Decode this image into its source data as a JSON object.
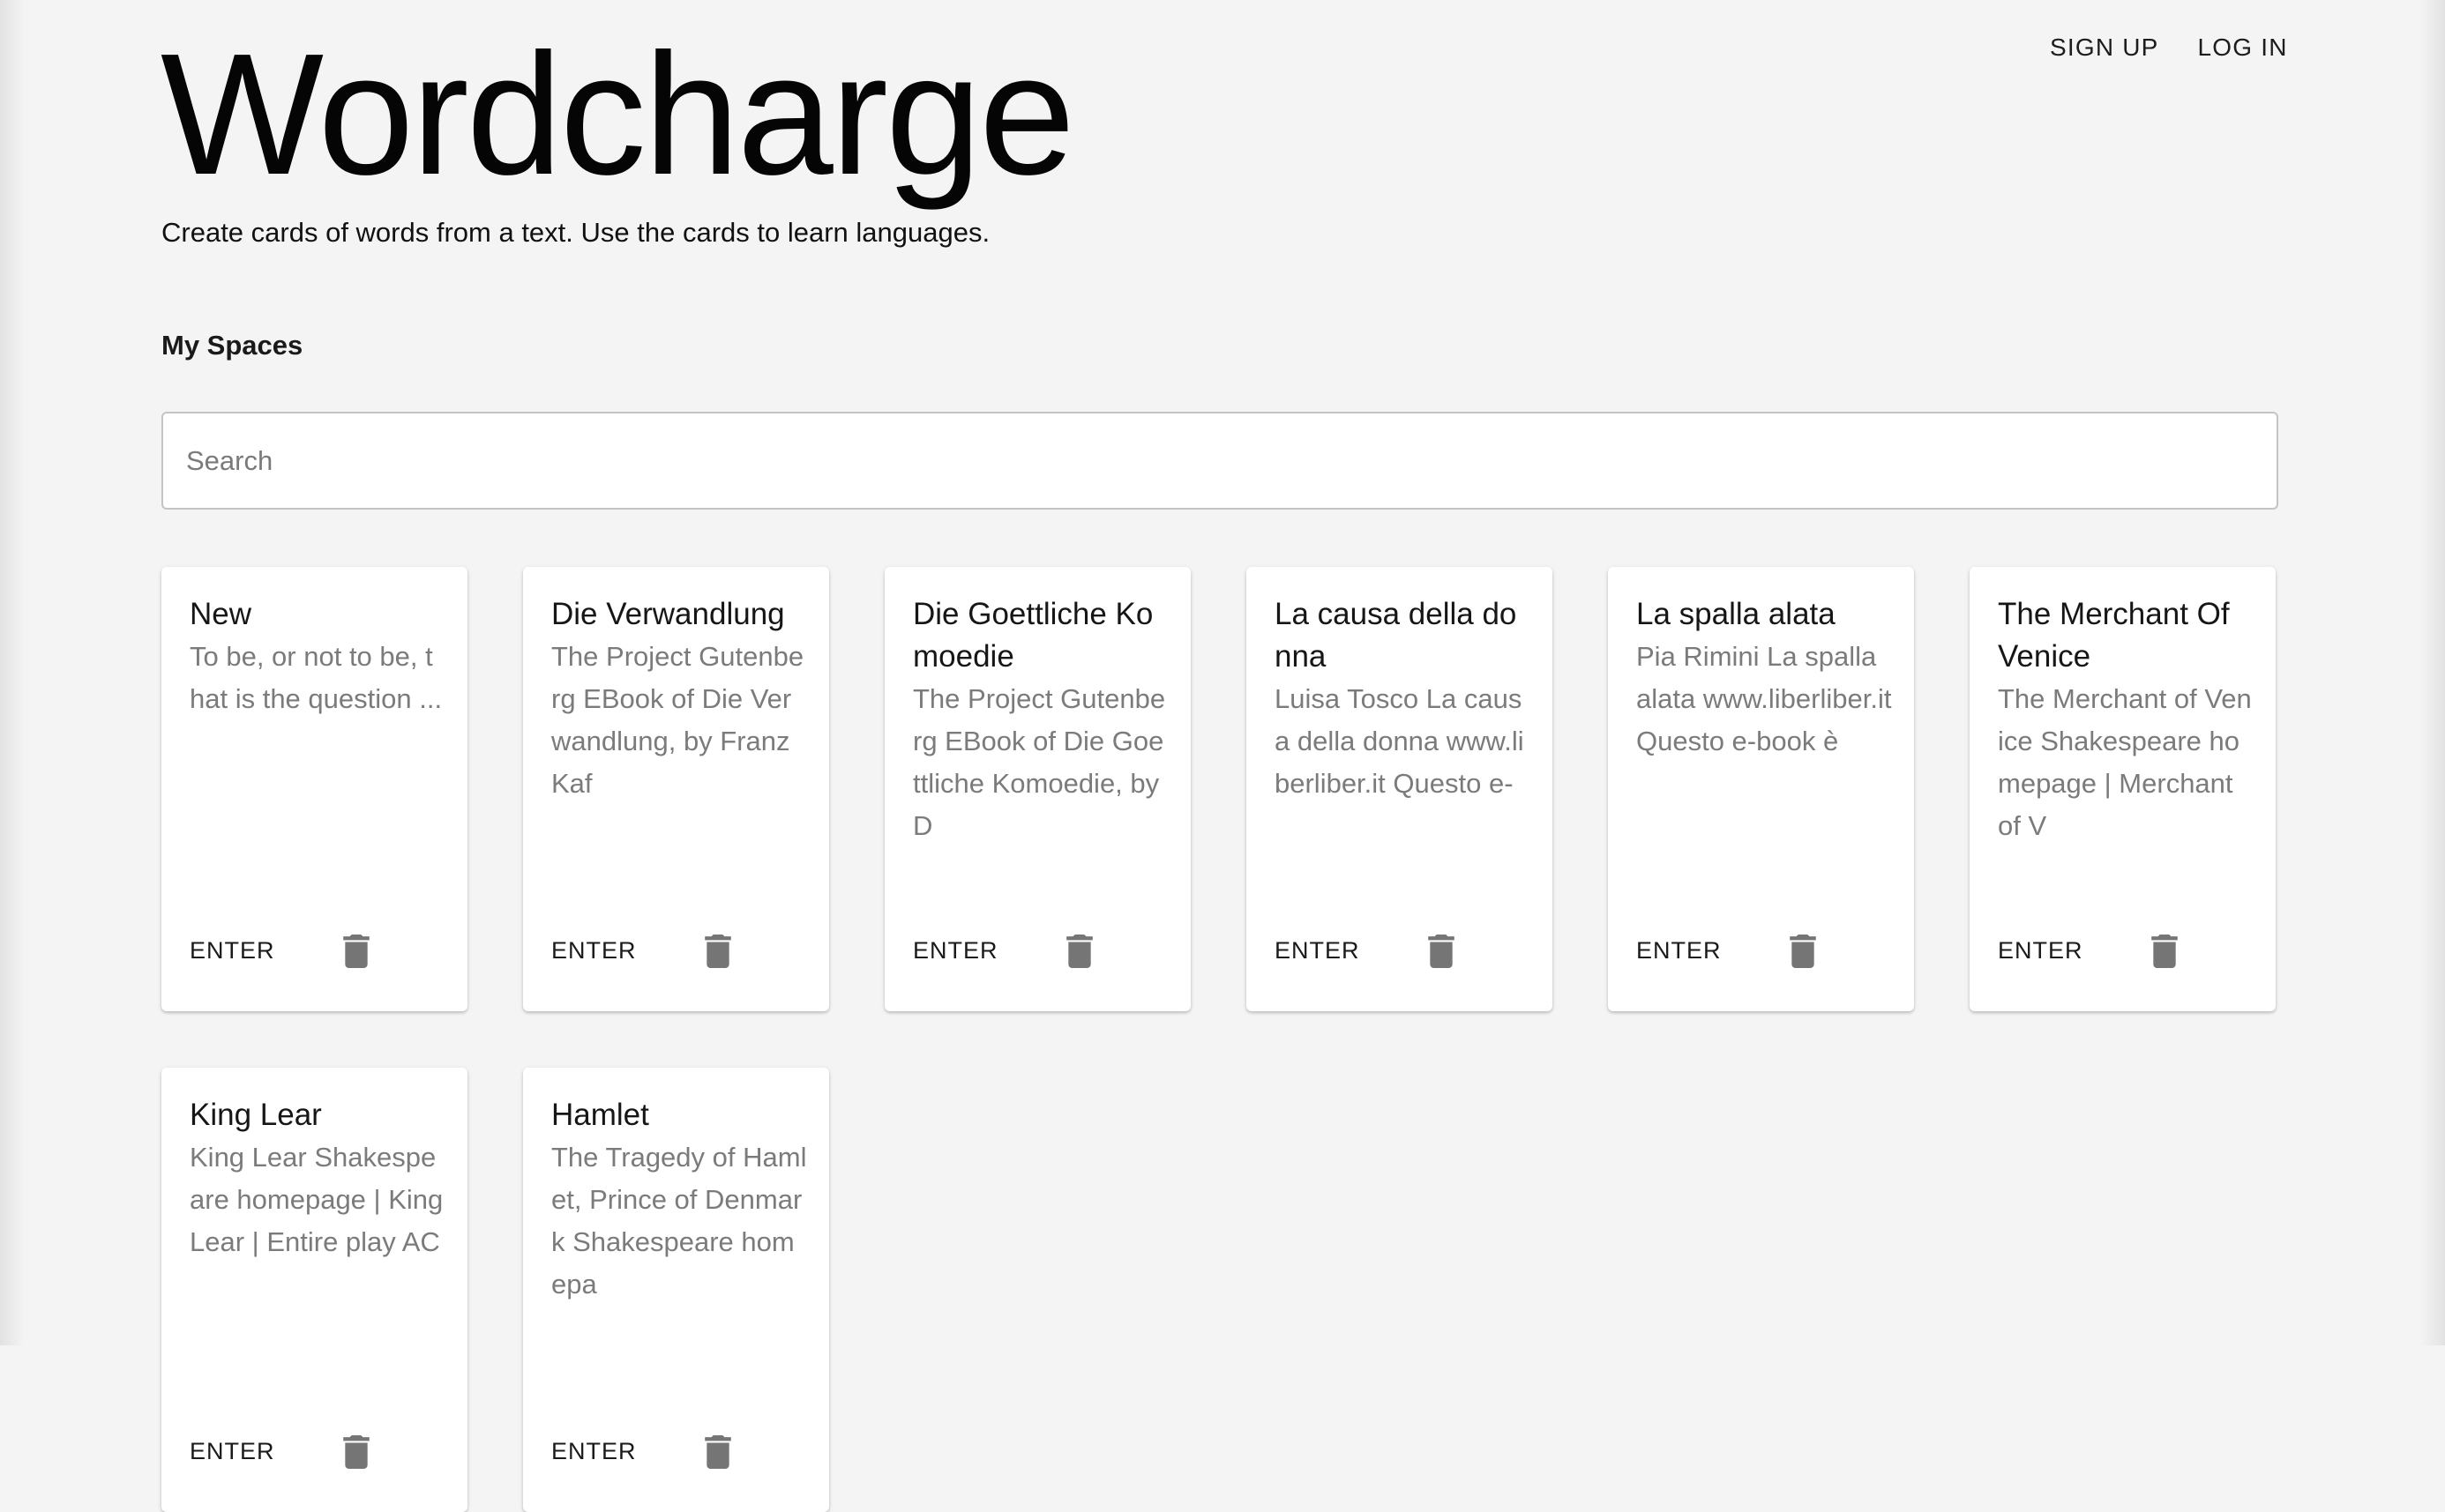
{
  "header": {
    "title": "Wordcharge",
    "tagline": "Create cards of words from a text. Use the cards to learn languages.",
    "nav": {
      "sign_up": "SIGN UP",
      "log_in": "LOG IN"
    }
  },
  "spaces": {
    "section_title": "My Spaces",
    "search": {
      "placeholder": "Search",
      "value": ""
    },
    "cards": [
      {
        "title": "New",
        "description": "To be, or not to be, that is the question ...",
        "enter_label": "ENTER",
        "delete_icon": "trash-icon"
      },
      {
        "title": "Die Verwandlung",
        "description": "The Project Gutenberg EBook of Die Verwandlung, by Franz Kaf",
        "enter_label": "ENTER",
        "delete_icon": "trash-icon"
      },
      {
        "title": "Die Goettliche Komoedie",
        "description": "The Project Gutenberg EBook of Die Goettliche Komoedie, by D",
        "enter_label": "ENTER",
        "delete_icon": "trash-icon"
      },
      {
        "title": "La causa della donna",
        "description": "Luisa Tosco La causa della donna www.liberliber.it Questo e-",
        "enter_label": "ENTER",
        "delete_icon": "trash-icon"
      },
      {
        "title": "La spalla alata",
        "description": "Pia Rimini La spalla alata www.liberliber.it Questo e-book è",
        "enter_label": "ENTER",
        "delete_icon": "trash-icon"
      },
      {
        "title": "The Merchant Of Venice",
        "description": "The Merchant of Venice Shakespeare homepage | Merchant of V",
        "enter_label": "ENTER",
        "delete_icon": "trash-icon"
      },
      {
        "title": "King Lear",
        "description": "King Lear Shakespeare homepage | King Lear | Entire play AC",
        "enter_label": "ENTER",
        "delete_icon": "trash-icon"
      },
      {
        "title": "Hamlet",
        "description": "The Tragedy of Hamlet, Prince of Denmark Shakespeare homepa",
        "enter_label": "ENTER",
        "delete_icon": "trash-icon"
      }
    ]
  },
  "colors": {
    "background": "#f4f4f4",
    "card": "#ffffff",
    "muted_text": "#7b7b7b",
    "icon": "#757575"
  }
}
